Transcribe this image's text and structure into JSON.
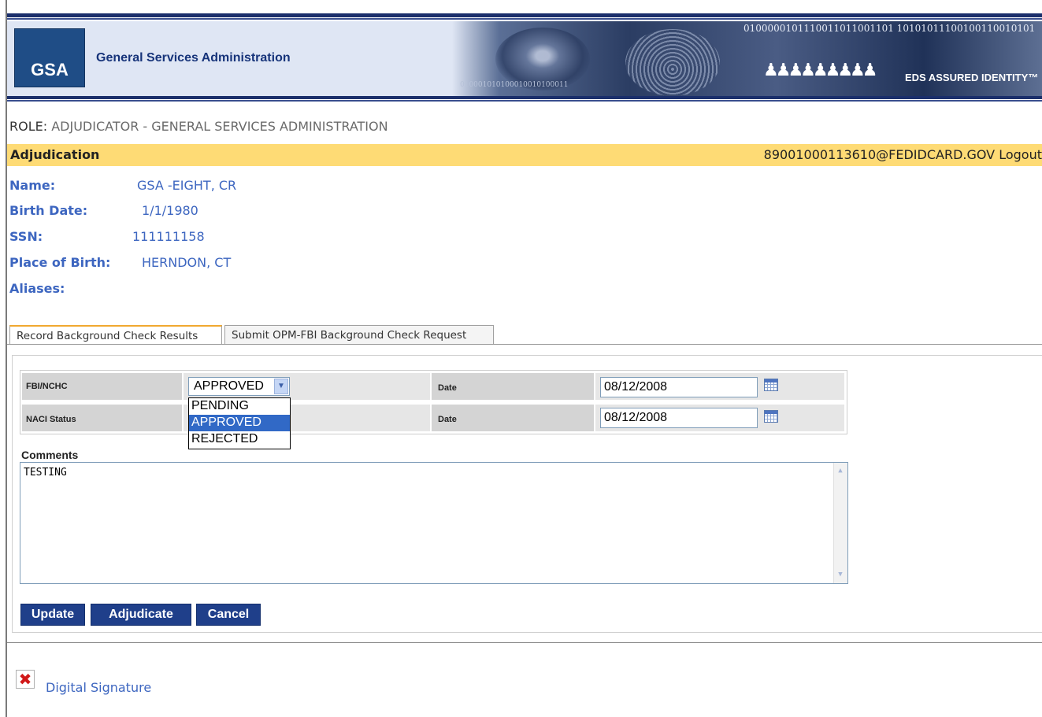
{
  "header": {
    "logo_text": "GSA",
    "agency_name": "General Services Administration",
    "hero_bits_top": "0100000101110011011001101 10101011100100110010101",
    "hero_bits_bottom": "010001010100010010100011",
    "hero_caption": "EDS ASSURED IDENTITY™"
  },
  "role": {
    "key": "ROLE:",
    "value": "ADJUDICATOR -  GENERAL SERVICES ADMINISTRATION"
  },
  "adjudication_bar": {
    "title": "Adjudication",
    "user": "89001000113610@FEDIDCARD.GOV",
    "logout": "Logout"
  },
  "person": {
    "name_label": "Name:",
    "name_value": "GSA -EIGHT, CR",
    "birth_label": "Birth Date:",
    "birth_value": "1/1/1980",
    "ssn_label": "SSN:",
    "ssn_value": "111111158",
    "pob_label": "Place of Birth:",
    "pob_value": "HERNDON, CT",
    "aliases_label": "Aliases:"
  },
  "tabs": [
    {
      "label": "Record Background Check Results",
      "active": true
    },
    {
      "label": "Submit OPM-FBI Background Check Request",
      "active": false
    }
  ],
  "form": {
    "fbi_label": "FBI/NCHC",
    "fbi_selected": "APPROVED",
    "naci_label": "NACI Status",
    "date_label": "Date",
    "fbi_date": "08/12/2008",
    "naci_date": "08/12/2008",
    "dropdown_options": [
      "PENDING",
      "APPROVED",
      "REJECTED"
    ],
    "comments_label": "Comments",
    "comments_value": "TESTING"
  },
  "buttons": {
    "update": "Update",
    "adjudicate": "Adjudicate",
    "cancel": "Cancel"
  },
  "footer": {
    "signature_link": "Digital Signature"
  },
  "colors": {
    "navy": "#1b2f6b",
    "bar_yellow": "#fedb75",
    "link_blue": "#3d66c0",
    "button_blue": "#1f3f8a",
    "selection_blue": "#3169c6"
  },
  "icons": [
    "calendar-icon",
    "dropdown-arrow-icon",
    "broken-image-icon"
  ]
}
